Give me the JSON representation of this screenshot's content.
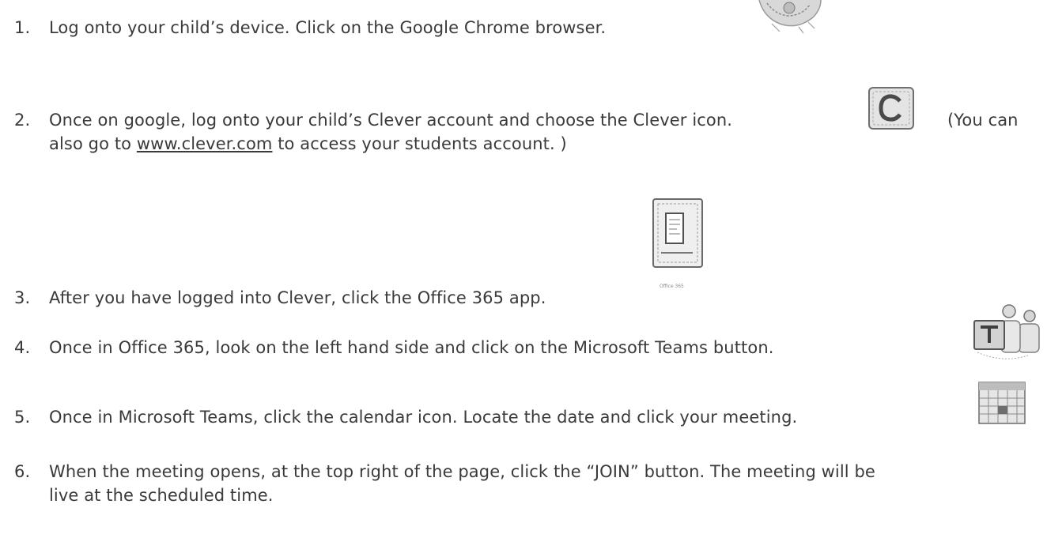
{
  "steps": [
    {
      "num": "1.",
      "text": "Log onto your child’s device. Click on the Google Chrome browser."
    },
    {
      "num": "2.",
      "text_a": "Once on google, log onto your child’s Clever account and choose the Clever icon.",
      "text_b": "(You can",
      "line2_pre": "also go to ",
      "link": "www.clever.com",
      "line2_post": " to access your students account. )"
    },
    {
      "num": "3.",
      "text": "After you have logged into Clever, click the Office 365 app."
    },
    {
      "num": "4.",
      "text": "Once in Office 365, look on the left hand side and click on the Microsoft Teams button."
    },
    {
      "num": "5.",
      "text": "Once in Microsoft Teams, click the calendar icon. Locate the date and click your meeting."
    },
    {
      "num": "6.",
      "line1": "When the meeting opens, at the top right of the page, click the “JOIN” button. The meeting will be",
      "line2": "live at the scheduled time."
    }
  ],
  "icons": {
    "chrome": "chrome-icon",
    "clever": "clever-icon",
    "office": "office-365-icon",
    "office_caption": "Office 365",
    "teams": "microsoft-teams-icon",
    "calendar": "calendar-icon"
  }
}
